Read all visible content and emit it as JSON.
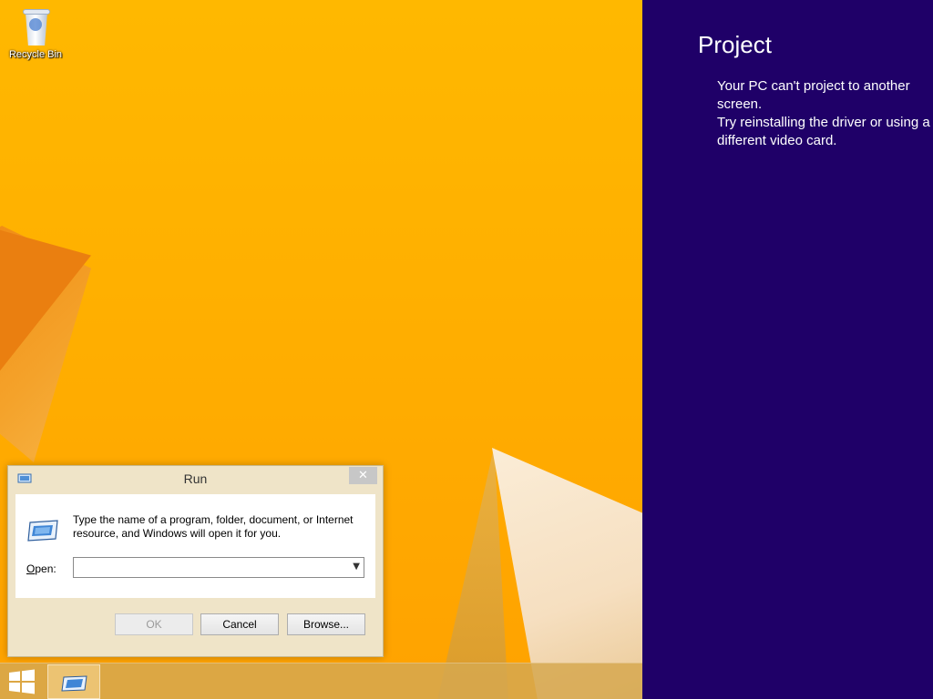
{
  "desktop": {
    "icons": [
      {
        "label": "Recycle Bin",
        "icon": "recycle-bin-icon"
      }
    ]
  },
  "run_dialog": {
    "title": "Run",
    "description": "Type the name of a program, folder, document, or Internet resource, and Windows will open it for you.",
    "open_label": "Open:",
    "open_value": "",
    "ok_label": "OK",
    "cancel_label": "Cancel",
    "browse_label": "Browse...",
    "close_glyph": "✕"
  },
  "taskbar": {
    "start_icon": "windows-logo-icon",
    "pinned": [
      {
        "icon": "run-icon",
        "active": true
      }
    ]
  },
  "charm": {
    "title": "Project",
    "message": "Your PC can't project to another screen.\nTry reinstalling the driver or using a\ndifferent video card.",
    "background": "#1f0068"
  },
  "colors": {
    "wallpaper": "#ffb000",
    "charm_background": "#1f0068",
    "dialog_frame": "#efe4c8"
  }
}
